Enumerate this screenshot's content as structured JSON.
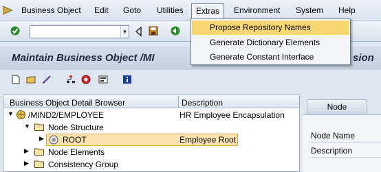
{
  "menu": {
    "items": [
      {
        "label": "Business Object"
      },
      {
        "label": "Edit"
      },
      {
        "label": "Goto"
      },
      {
        "label": "Utilities"
      },
      {
        "label": "Extras"
      },
      {
        "label": "Environment"
      },
      {
        "label": "System"
      },
      {
        "label": "Help"
      }
    ]
  },
  "extras_menu": {
    "items": [
      {
        "label": "Propose Repository Names",
        "highlighted": true
      },
      {
        "label": "Generate Dictionary Elements"
      },
      {
        "label": "Generate Constant Interface"
      }
    ]
  },
  "title": "Maintain Business Object /MIND2/EMPLOYEE - Revision",
  "title_visible_left": "Maintain Business Object /MI",
  "title_visible_right": "sion",
  "tree": {
    "headers": {
      "col1": "Business Object Detail Browser",
      "col2": "Description"
    },
    "rows": [
      {
        "label": "/MIND2/EMPLOYEE",
        "description": "HR Employee Encapsulation"
      },
      {
        "label": "Node Structure",
        "description": ""
      },
      {
        "label": "ROOT",
        "description": "Employee Root",
        "selected": true
      },
      {
        "label": "Node Elements",
        "description": ""
      },
      {
        "label": "Consistency Group",
        "description": ""
      }
    ]
  },
  "detail": {
    "tab": "Node",
    "fields": [
      {
        "label": "Node Name"
      },
      {
        "label": "Description"
      }
    ]
  },
  "colors": {
    "highlight": "#f9d874",
    "selection": "#fbe3b0",
    "title": "#1b2b44"
  }
}
